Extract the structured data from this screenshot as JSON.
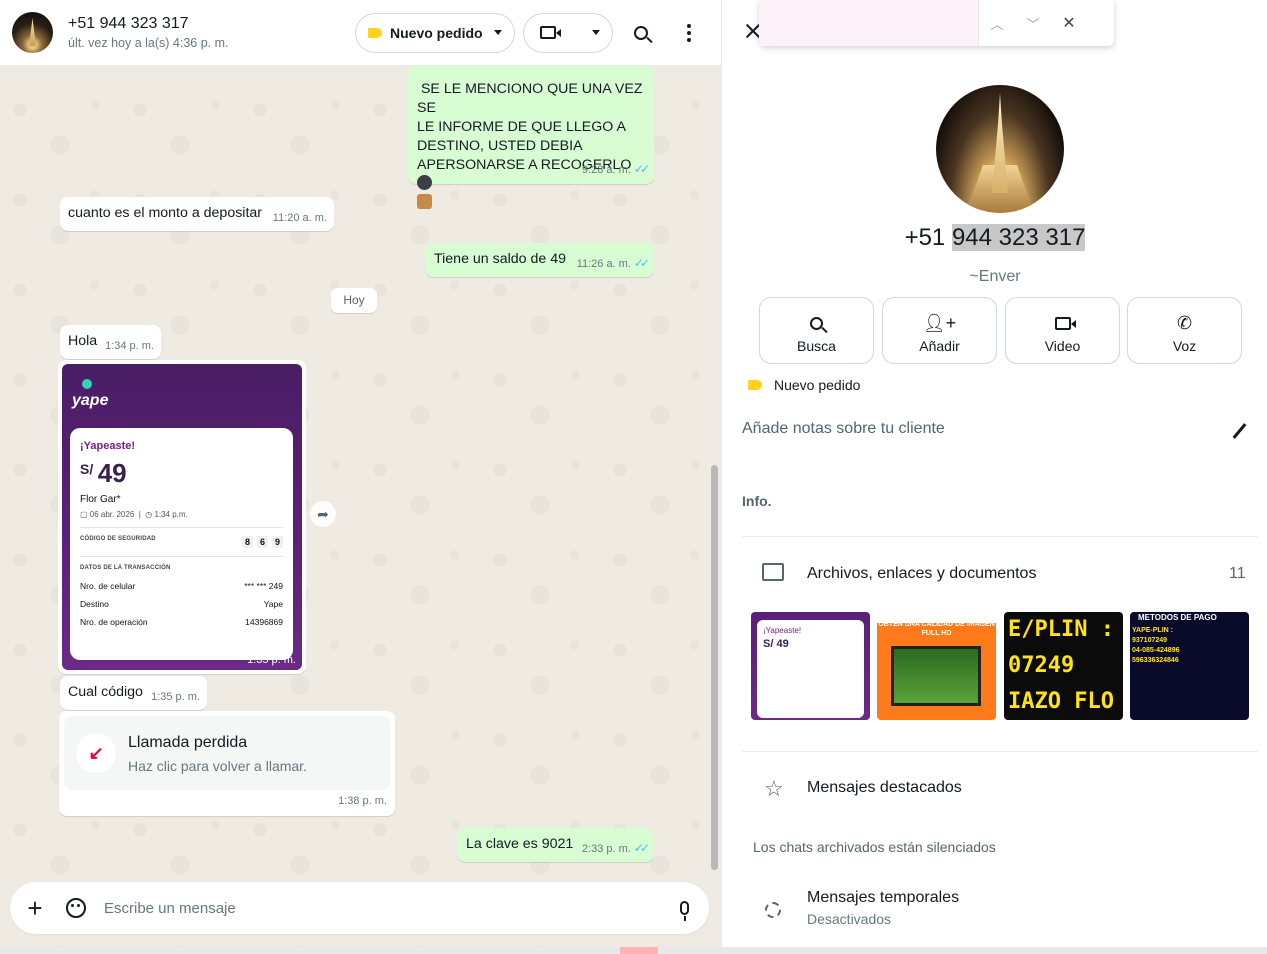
{
  "chat_header": {
    "contact_name": "+51 944 323 317",
    "last_seen": "últ. vez hoy a la(s) 4:36 p. m.",
    "order_label": "Nuevo pedido"
  },
  "messages": [
    {
      "dir": "out",
      "lines": [
        "SE LE MENCIONO QUE UNA VEZ SE",
        "LE INFORME DE QUE LLEGO A",
        "DESTINO, USTED DEBIA",
        "APERSONARSE A RECOGERLO"
      ],
      "time": "9:28 a. m."
    },
    {
      "dir": "in",
      "text": "cuanto es el monto a depositar",
      "time": "11:20 a. m."
    },
    {
      "dir": "out",
      "text": "Tiene un saldo de 49",
      "time": "11:26 a. m."
    },
    {
      "dir": "in",
      "text": "Hola",
      "time": "1:34 p. m."
    },
    {
      "dir": "in",
      "text": "Cual código",
      "time": "1:35 p. m."
    },
    {
      "dir": "out",
      "text": "La clave es 9021",
      "time": "2:33 p. m."
    }
  ],
  "date_chip": "Hoy",
  "yape_receipt": {
    "logo": "yape",
    "title": "¡Yapeaste!",
    "currency": "S/",
    "amount": "49",
    "name": "Flor Gar*",
    "date": "06 abr. 2026",
    "time_label": "1:34 p.m.",
    "security_code_label": "CÓDIGO DE SEGURIDAD",
    "security_code": [
      "8",
      "6",
      "9"
    ],
    "transaction_label": "DATOS DE LA TRANSACCIÓN",
    "rows": [
      {
        "label": "Nro. de celular",
        "value": "*** *** 249"
      },
      {
        "label": "Destino",
        "value": "Yape"
      },
      {
        "label": "Nro. de operación",
        "value": "14396869"
      }
    ],
    "msg_time": "1:35 p. m."
  },
  "missed_call": {
    "title": "Llamada perdida",
    "subtitle": "Haz clic para volver a llamar.",
    "time": "1:38 p. m."
  },
  "composer": {
    "placeholder": "Escribe un mensaje"
  },
  "contact_info": {
    "phone_prefix": "+51",
    "phone_highlighted": "944 323 317",
    "alias": "~Enver",
    "actions": [
      "Busca",
      "Añadir",
      "Video",
      "Voz"
    ],
    "order_tag": "Nuevo pedido",
    "notes_placeholder": "Añade notas sobre tu cliente",
    "info_label": "Info.",
    "media_title": "Archivos, enlaces y documentos",
    "media_count": "11",
    "thumbs": {
      "t1_title": "¡Yapeaste!",
      "t1_amount": "S/ 49",
      "t2_text": "OBTEN UNA CALIDAD DE IMAGEN FULL HD",
      "t3_lines": [
        "E/PLIN :",
        "07249",
        "IAZO FLO"
      ],
      "t4_title": "METODOS DE PAGO",
      "t4_lines": [
        "YAPE-PLIN :",
        "937107249",
        "04-085-424896",
        "596336324846"
      ]
    },
    "starred_title": "Mensajes destacados",
    "archived_note": "Los chats archivados están silenciados",
    "temp_title": "Mensajes temporales",
    "temp_sub": "Desactivados"
  }
}
